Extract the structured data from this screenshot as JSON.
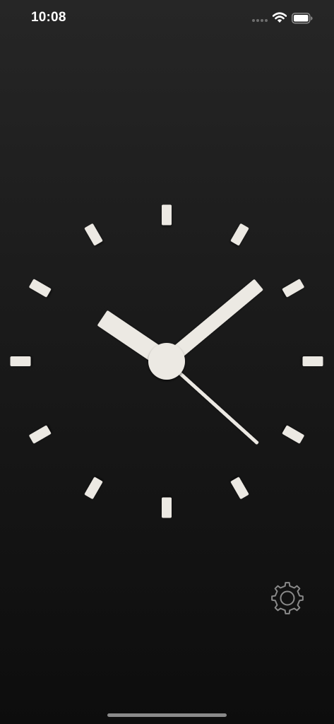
{
  "status_bar": {
    "time": "10:08",
    "icons": [
      "cellular-signal-icon",
      "wifi-icon",
      "battery-icon"
    ]
  },
  "clock": {
    "hours": 10,
    "minutes": 8,
    "seconds": 22,
    "tick_count": 12,
    "colors": {
      "hands": "#ece9e3",
      "ticks": "#ece9e3",
      "hub": "#ece9e3"
    }
  },
  "controls": {
    "settings_icon": "gear-icon"
  },
  "colors": {
    "background_top": "#262626",
    "background_bottom": "#0d0d0d",
    "status_text": "#ffffff",
    "home_indicator": "#8a8a8a"
  }
}
